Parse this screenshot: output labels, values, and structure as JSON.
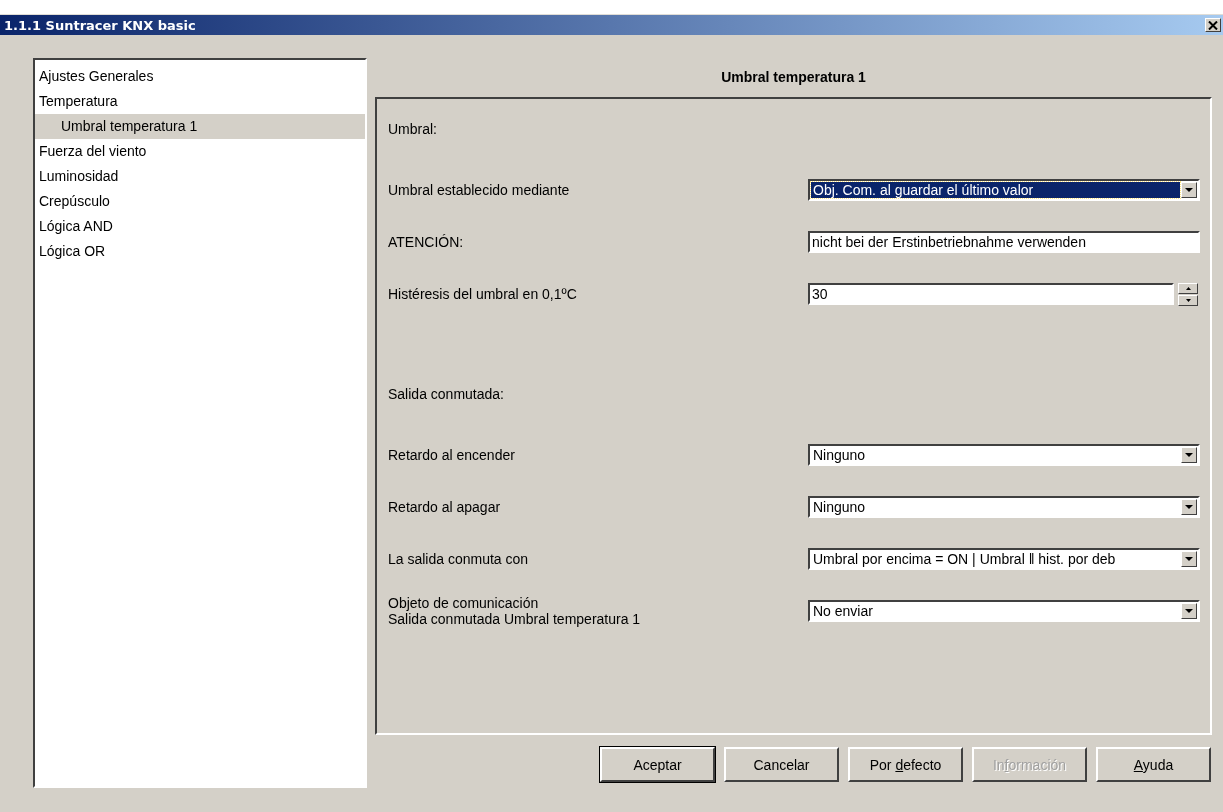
{
  "window": {
    "title": "1.1.1 Suntracer KNX basic"
  },
  "tree": [
    {
      "label": "Ajustes Generales",
      "selected": false
    },
    {
      "label": "Temperatura",
      "selected": false,
      "children": [
        {
          "label": "Umbral temperatura 1",
          "selected": true
        }
      ]
    },
    {
      "label": "Fuerza del viento",
      "selected": false
    },
    {
      "label": "Luminosidad",
      "selected": false
    },
    {
      "label": "Crepúsculo",
      "selected": false
    },
    {
      "label": "Lógica AND",
      "selected": false
    },
    {
      "label": "Lógica OR",
      "selected": false
    }
  ],
  "panel": {
    "title": "Umbral temperatura 1",
    "rows": [
      {
        "kind": "section",
        "label": "Umbral:"
      },
      {
        "kind": "select",
        "label": "Umbral establecido mediante",
        "value": "Obj. Com. al guardar el último valor",
        "focused": true
      },
      {
        "kind": "text",
        "label": "ATENCIÓN:",
        "value": "nicht bei der Erstinbetriebnahme verwenden"
      },
      {
        "kind": "spin",
        "label": "Histéresis del umbral en 0,1ºC",
        "value": "30"
      },
      {
        "kind": "section",
        "label": "Salida conmutada:"
      },
      {
        "kind": "select",
        "label": "Retardo al encender",
        "value": "Ninguno",
        "focused": false
      },
      {
        "kind": "select",
        "label": "Retardo al apagar",
        "value": "Ninguno",
        "focused": false
      },
      {
        "kind": "select",
        "label": "La salida conmuta con",
        "value": "Umbral por encima = ON | Umbral ‖ hist. por deb",
        "focused": false
      },
      {
        "kind": "select",
        "label": "Objeto de comunicación\nSalida conmutada Umbral temperatura 1",
        "value": "No enviar",
        "focused": false
      }
    ]
  },
  "buttons": [
    {
      "before": "Aceptar",
      "default": true,
      "disabled": false
    },
    {
      "before": "Cancelar",
      "default": false,
      "disabled": false
    },
    {
      "before": "Por ",
      "key": "d",
      "after": "efecto",
      "default": false,
      "disabled": false
    },
    {
      "before": "In",
      "key": "f",
      "after": "ormación",
      "default": false,
      "disabled": true
    },
    {
      "key": "A",
      "after": "yuda",
      "default": false,
      "disabled": false
    }
  ]
}
